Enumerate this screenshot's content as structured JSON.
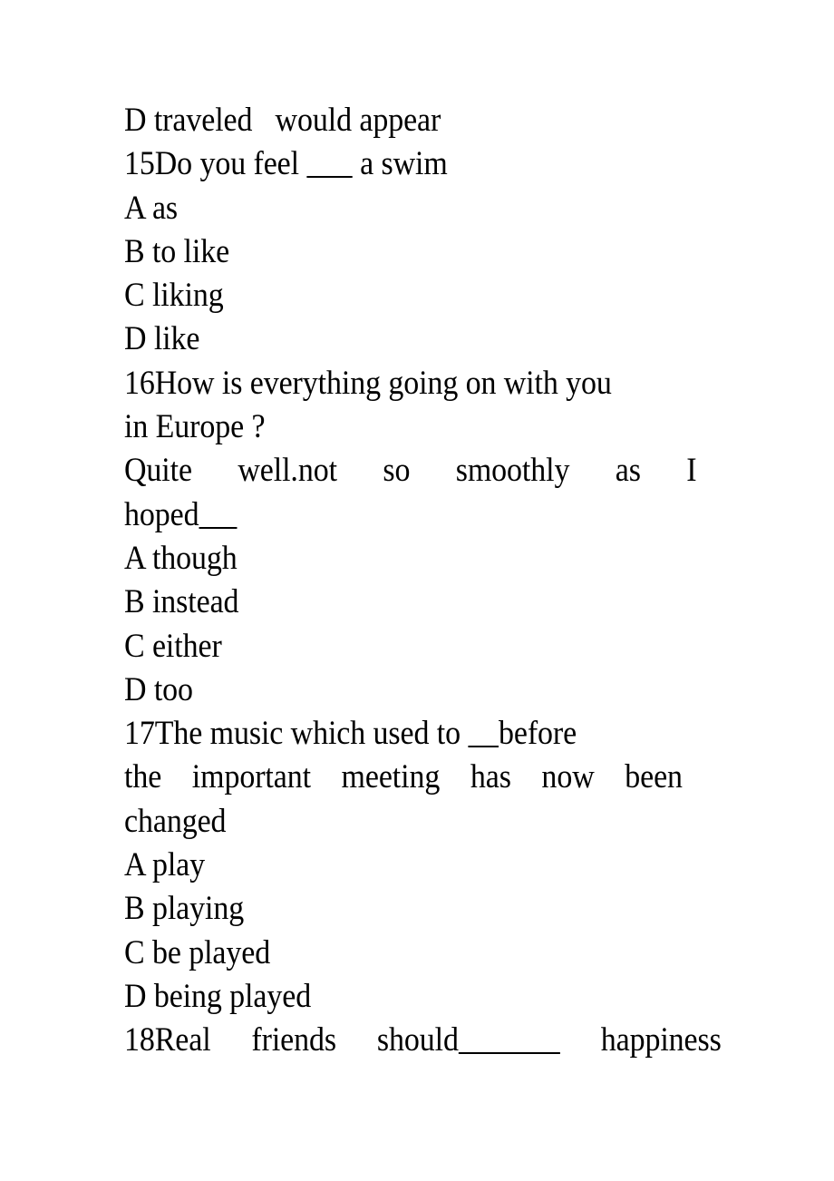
{
  "document": {
    "type": "english-grammar-multiple-choice-worksheet",
    "page_background": "#ffffff",
    "text_color": "#000000",
    "lines": [
      {
        "id": "l1",
        "text": "D traveled   would appear",
        "style": "plain"
      },
      {
        "id": "l2",
        "text": "15Do you feel ______ a swim",
        "style": "plain"
      },
      {
        "id": "l3",
        "text": "A as",
        "style": "plain"
      },
      {
        "id": "l4",
        "text": "B to like",
        "style": "plain"
      },
      {
        "id": "l5",
        "text": "C liking",
        "style": "plain"
      },
      {
        "id": "l6",
        "text": "D like",
        "style": "plain"
      },
      {
        "id": "l7",
        "text": "16How is everything going on with you",
        "style": "plain"
      },
      {
        "id": "l8",
        "text": "in Europe ?",
        "style": "plain"
      },
      {
        "id": "l9",
        "text": "Quite   well.not   so   smoothly   as   I",
        "style": "justified"
      },
      {
        "id": "l10",
        "text": "hoped_____",
        "style": "plain"
      },
      {
        "id": "l11",
        "text": "A though",
        "style": "plain"
      },
      {
        "id": "l12",
        "text": "B instead",
        "style": "plain"
      },
      {
        "id": "l13",
        "text": "C either",
        "style": "plain"
      },
      {
        "id": "l14",
        "text": "D too",
        "style": "plain"
      },
      {
        "id": "l15",
        "text": "17The music which used to ____before",
        "style": "plain"
      },
      {
        "id": "l16",
        "text": "the  important  meeting  has  now  been",
        "style": "justified"
      },
      {
        "id": "l17",
        "text": "changed",
        "style": "plain"
      },
      {
        "id": "l18",
        "text": "A play",
        "style": "plain"
      },
      {
        "id": "l19",
        "text": "B playing",
        "style": "plain"
      },
      {
        "id": "l20",
        "text": "C be played",
        "style": "plain"
      },
      {
        "id": "l21",
        "text": "D being played",
        "style": "plain"
      },
      {
        "id": "l22",
        "text": "18Real  friends  should_____  happiness",
        "style": "justified"
      }
    ],
    "questions": [
      {
        "number": "15",
        "stem": "15Do you feel ______ a swim",
        "options": [
          {
            "letter": "A",
            "text": "A as"
          },
          {
            "letter": "B",
            "text": "B to like"
          },
          {
            "letter": "C",
            "text": "C liking"
          },
          {
            "letter": "D",
            "text": "D like"
          }
        ]
      },
      {
        "number": "16",
        "stem": "16How is everything going on with you in Europe ?",
        "response": "Quite well.not so smoothly as I hoped_____",
        "options": [
          {
            "letter": "A",
            "text": "A though"
          },
          {
            "letter": "B",
            "text": "B instead"
          },
          {
            "letter": "C",
            "text": "C either"
          },
          {
            "letter": "D",
            "text": "D too"
          }
        ]
      },
      {
        "number": "17",
        "stem": "17The music which used to ____before the important meeting has now been changed",
        "options": [
          {
            "letter": "A",
            "text": "A play"
          },
          {
            "letter": "B",
            "text": "B playing"
          },
          {
            "letter": "C",
            "text": "C be played"
          },
          {
            "letter": "D",
            "text": "D being played"
          }
        ]
      },
      {
        "number": "18",
        "stem": "18Real friends should_____ happiness",
        "options": []
      }
    ],
    "previous_question_tail": {
      "option_letter": "D",
      "text": "D traveled   would appear"
    }
  }
}
